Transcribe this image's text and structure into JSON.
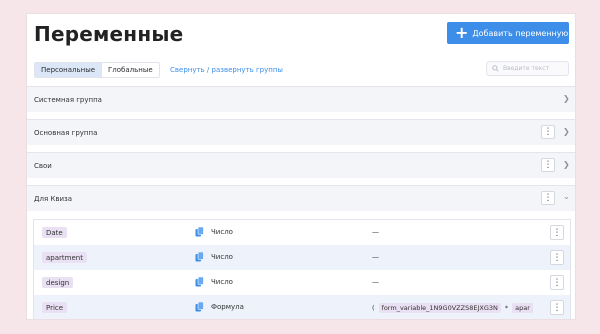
{
  "page": {
    "title": "Переменные",
    "add_button_label": "Добавить переменную",
    "tabs": [
      {
        "label": "Персональные",
        "active": true
      },
      {
        "label": "Глобальные",
        "active": false
      }
    ],
    "collapse_link": "Свернуть / развернуть группы",
    "search_placeholder": "Введите текст"
  },
  "groups": [
    {
      "name": "Системная группа",
      "has_menu": false,
      "expanded": false
    },
    {
      "name": "Основная группа",
      "has_menu": true,
      "expanded": false
    },
    {
      "name": "Свои",
      "has_menu": true,
      "expanded": false
    },
    {
      "name": "Для Квиза",
      "has_menu": true,
      "expanded": true
    }
  ],
  "variables": [
    {
      "name": "Date",
      "type": "Число",
      "value": "—"
    },
    {
      "name": "apartment",
      "type": "Число",
      "value": "—"
    },
    {
      "name": "design",
      "type": "Число",
      "value": "—"
    },
    {
      "name": "Price",
      "type": "Формула",
      "value": "",
      "formula": {
        "paren": "(",
        "token1": "form_variable_1N9G0VZZS8EJXG3N",
        "operator": "*",
        "token2": "apar"
      }
    }
  ],
  "colors": {
    "accent": "#3d8ee8",
    "pill": "#e9e1f3",
    "row_alt": "#eef2fb",
    "group_bg": "#f4f5f9"
  },
  "icons": {
    "add": "plus-icon",
    "search": "search-icon",
    "copy": "copy-icon",
    "menu": "kebab-icon",
    "chevron_right": "chevron-right-icon",
    "chevron_down": "chevron-down-icon"
  }
}
